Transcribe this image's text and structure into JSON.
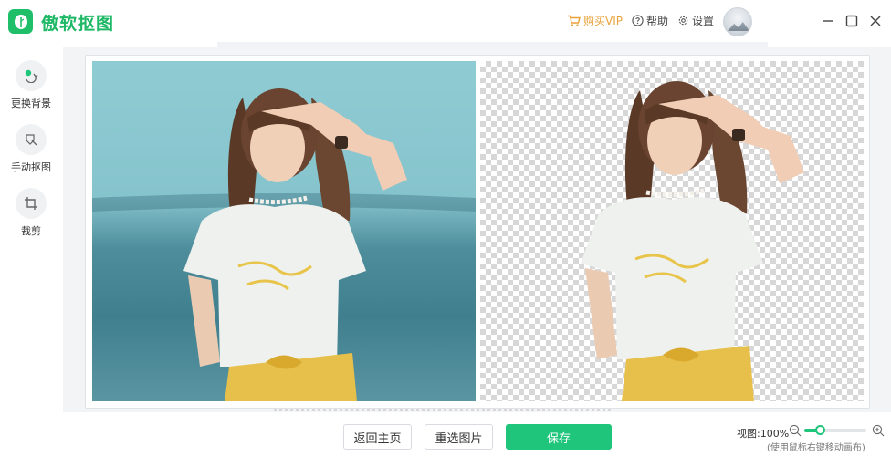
{
  "app": {
    "name": "傲软抠图"
  },
  "header": {
    "vip_label": "购买VIP",
    "help_label": "帮助",
    "settings_label": "设置"
  },
  "sidebar": {
    "items": [
      {
        "label": "更换背景",
        "icon": "replace-background-icon"
      },
      {
        "label": "手动抠图",
        "icon": "manual-cutout-icon"
      },
      {
        "label": "裁剪",
        "icon": "crop-icon"
      }
    ]
  },
  "footer": {
    "back_label": "返回主页",
    "reselect_label": "重选图片",
    "save_label": "保存",
    "zoom_label": "视图:100%",
    "zoom_hint": "(使用鼠标右键移动画布)",
    "zoom_level": 0.25
  },
  "colors": {
    "brand": "#1fb866",
    "primary_button": "#1fc57b",
    "vip": "#e8a23a"
  }
}
